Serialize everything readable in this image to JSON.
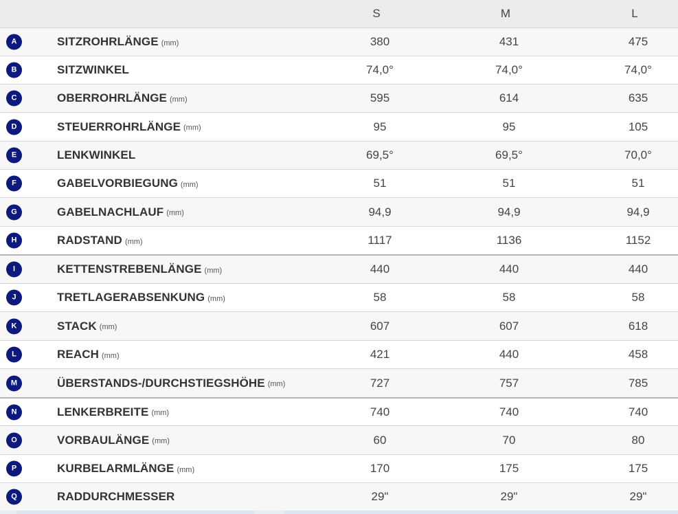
{
  "header": {
    "sizes": [
      "S",
      "M",
      "L"
    ]
  },
  "rows": [
    {
      "letter": "A",
      "name": "SITZROHRLÄNGE",
      "unit": "(mm)",
      "s": "380",
      "m": "431",
      "l": "475"
    },
    {
      "letter": "B",
      "name": "SITZWINKEL",
      "unit": "",
      "s": "74,0°",
      "m": "74,0°",
      "l": "74,0°"
    },
    {
      "letter": "C",
      "name": "OBERROHRLÄNGE",
      "unit": "(mm)",
      "s": "595",
      "m": "614",
      "l": "635"
    },
    {
      "letter": "D",
      "name": "STEUERROHRLÄNGE",
      "unit": "(mm)",
      "s": "95",
      "m": "95",
      "l": "105"
    },
    {
      "letter": "E",
      "name": "LENKWINKEL",
      "unit": "",
      "s": "69,5°",
      "m": "69,5°",
      "l": "70,0°"
    },
    {
      "letter": "F",
      "name": "GABELVORBIEGUNG",
      "unit": "(mm)",
      "s": "51",
      "m": "51",
      "l": "51"
    },
    {
      "letter": "G",
      "name": "GABELNACHLAUF",
      "unit": "(mm)",
      "s": "94,9",
      "m": "94,9",
      "l": "94,9"
    },
    {
      "letter": "H",
      "name": "RADSTAND",
      "unit": "(mm)",
      "s": "1117",
      "m": "1136",
      "l": "1152"
    },
    {
      "letter": "I",
      "name": "KETTENSTREBENLÄNGE",
      "unit": "(mm)",
      "s": "440",
      "m": "440",
      "l": "440"
    },
    {
      "letter": "J",
      "name": "TRETLAGERABSENKUNG",
      "unit": "(mm)",
      "s": "58",
      "m": "58",
      "l": "58"
    },
    {
      "letter": "K",
      "name": "STACK",
      "unit": "(mm)",
      "s": "607",
      "m": "607",
      "l": "618"
    },
    {
      "letter": "L",
      "name": "REACH",
      "unit": "(mm)",
      "s": "421",
      "m": "440",
      "l": "458"
    },
    {
      "letter": "M",
      "name": "ÜBERSTANDS-/DURCHSTIEGSHÖHE",
      "unit": "(mm)",
      "s": "727",
      "m": "757",
      "l": "785"
    },
    {
      "letter": "N",
      "name": "LENKERBREITE",
      "unit": "(mm)",
      "s": "740",
      "m": "740",
      "l": "740"
    },
    {
      "letter": "O",
      "name": "VORBAULÄNGE",
      "unit": "(mm)",
      "s": "60",
      "m": "70",
      "l": "80"
    },
    {
      "letter": "P",
      "name": "KURBELARMLÄNGE",
      "unit": "(mm)",
      "s": "170",
      "m": "175",
      "l": "175"
    },
    {
      "letter": "Q",
      "name": "RADDURCHMESSER",
      "unit": "",
      "s": "29\"",
      "m": "29\"",
      "l": "29\""
    }
  ],
  "colors": {
    "badge": "#0c1a7d",
    "header_bg": "#ececec",
    "row_alt_bg": "#f7f7f7"
  }
}
